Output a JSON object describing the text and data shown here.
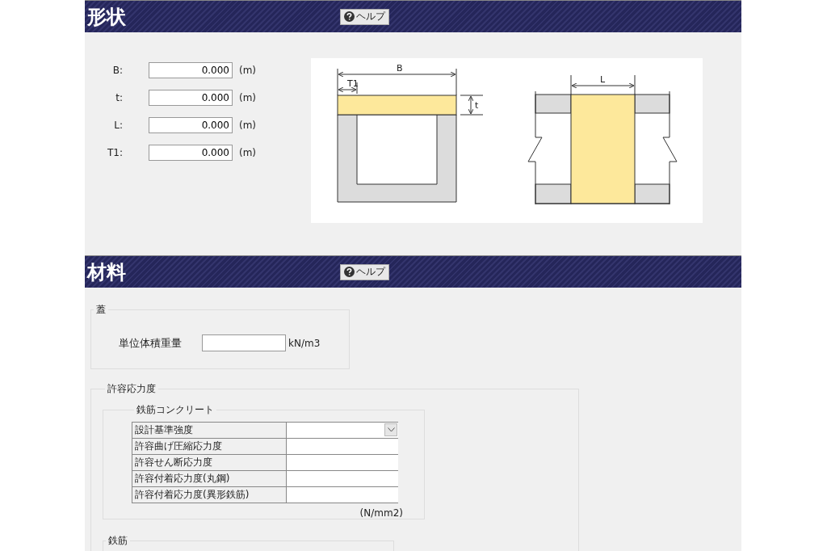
{
  "sections": [
    {
      "title": "形状",
      "help": "ヘルプ"
    },
    {
      "title": "材料",
      "help": "ヘルプ"
    }
  ],
  "shape": {
    "fields": [
      {
        "label": "B:",
        "value": "0.000",
        "unit": "(m)"
      },
      {
        "label": "t:",
        "value": "0.000",
        "unit": "(m)"
      },
      {
        "label": "L:",
        "value": "0.000",
        "unit": "(m)"
      },
      {
        "label": "T1:",
        "value": "0.000",
        "unit": "(m)"
      }
    ],
    "diagram": {
      "width_label": "B",
      "wall_label": "T1",
      "thickness_label": "t",
      "length_label": "L"
    }
  },
  "material": {
    "lid": {
      "legend": "蓋",
      "label": "単位体積重量",
      "unit": "kN/m3"
    },
    "allowable": {
      "legend": "許容応力度",
      "rc": {
        "legend": "鉄筋コンクリート",
        "rows": [
          {
            "label": "設計基準強度",
            "kind": "select"
          },
          {
            "label": "許容曲げ圧縮応力度",
            "kind": "text"
          },
          {
            "label": "許容せん断応力度",
            "kind": "text"
          },
          {
            "label": "許容付着応力度(丸鋼)",
            "kind": "text"
          },
          {
            "label": "許容付着応力度(異形鉄筋)",
            "kind": "text"
          }
        ],
        "unit": "(N/mm2)"
      },
      "rebar": {
        "legend": "鉄筋"
      }
    }
  }
}
